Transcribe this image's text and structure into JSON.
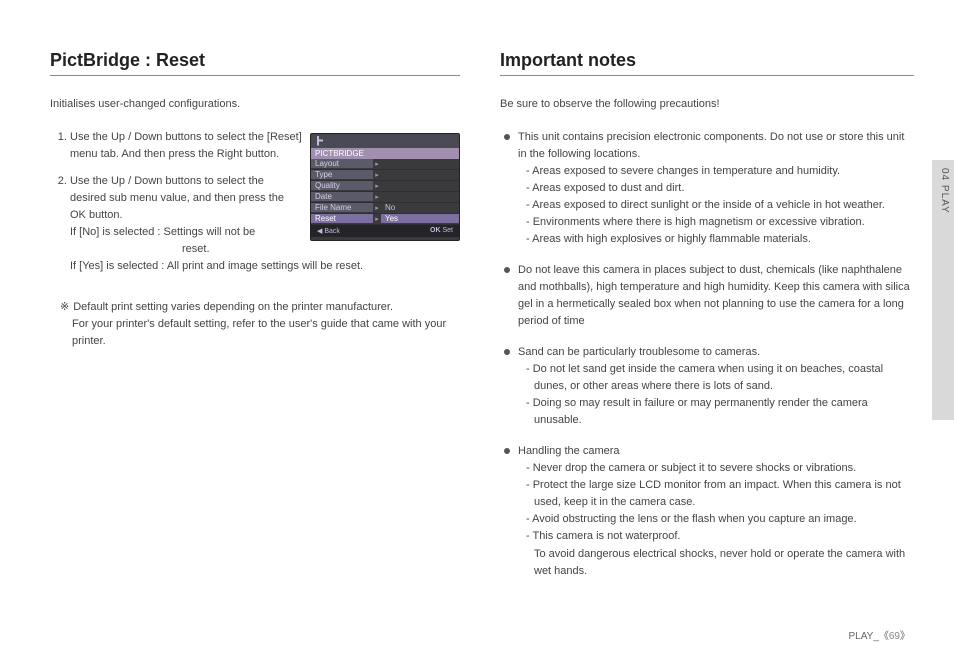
{
  "left": {
    "heading": "PictBridge : Reset",
    "intro": "Initialises user-changed configurations.",
    "step1": "Use the Up / Down buttons to select the [Reset] menu tab. And then press the Right button.",
    "step2_a": "Use the Up / Down buttons to select the desired sub menu value, and then press the OK button.",
    "step2_no": "If [No] is selected  : Settings will not be",
    "step2_no_cont": "reset.",
    "step2_yes": "If [Yes] is selected : All print and image settings will be reset.",
    "note_symbol": "※",
    "note1": "Default print setting varies depending on the printer manufacturer.",
    "note2": "For your printer's default setting, refer to the user's guide that came with your printer.",
    "lcd": {
      "title": "PICTBRIDGE",
      "rows": {
        "r0": "Layout",
        "r1": "Type",
        "r2": "Quality",
        "r3": "Date",
        "r4": "File Name",
        "r5": "Reset"
      },
      "opt_no": "No",
      "opt_yes": "Yes",
      "back_arrow": "◀",
      "back": "Back",
      "ok": "OK",
      "set": "Set"
    }
  },
  "right": {
    "heading": "Important notes",
    "intro": "Be sure to observe the following precautions!",
    "b1_head": "This unit contains precision electronic components. Do not use or store this unit in the following locations.",
    "b1_d1": "- Areas exposed to severe changes in temperature and humidity.",
    "b1_d2": "- Areas exposed to dust and dirt.",
    "b1_d3": "- Areas exposed to direct sunlight or the inside of a vehicle in hot weather.",
    "b1_d4": "- Environments where there is high magnetism or excessive vibration.",
    "b1_d5": "- Areas with high explosives or highly flammable materials.",
    "b2": "Do not leave this camera in places subject to dust, chemicals (like naphthalene and mothballs), high temperature and high humidity. Keep this camera with silica gel in a hermetically sealed box when not planning to use the camera for a long period of time",
    "b3_head": "Sand can be particularly troublesome to cameras.",
    "b3_d1": "- Do not let sand get inside the camera when using it on beaches, coastal dunes, or other areas where there is lots of sand.",
    "b3_d2": "- Doing so may result in failure or may permanently render the camera unusable.",
    "b4_head": "Handling the camera",
    "b4_d1": "- Never drop the camera or subject it to severe shocks or vibrations.",
    "b4_d2": "- Protect  the large size LCD monitor from an impact. When this camera is not used, keep it in the camera case.",
    "b4_d3": "- Avoid obstructing the lens or the flash when you capture an image.",
    "b4_d4": "- This camera is not waterproof.",
    "b4_d4b": "To avoid dangerous electrical shocks, never hold or operate the camera with wet hands."
  },
  "tab": "04 PLAY",
  "footer_prefix": "PLAY_",
  "footer_page": "69"
}
